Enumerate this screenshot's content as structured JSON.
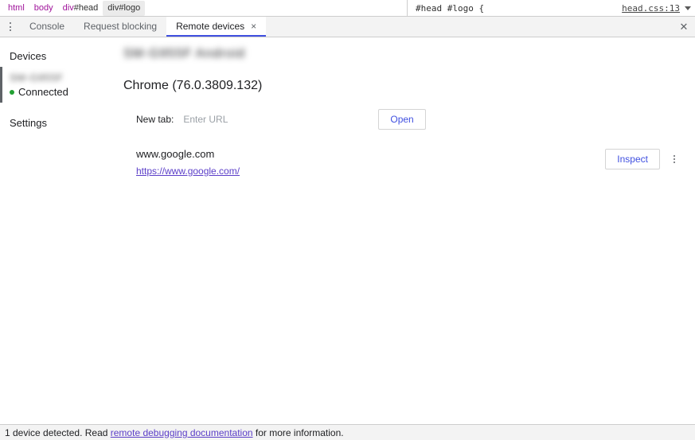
{
  "breadcrumb": {
    "items": [
      {
        "tag": "html",
        "id": "",
        "selected": false
      },
      {
        "tag": "body",
        "id": "",
        "selected": false
      },
      {
        "tag": "div",
        "id": "#head",
        "selected": false
      },
      {
        "tag": "div",
        "id": "#logo",
        "selected": true
      }
    ]
  },
  "styles_rule": {
    "selector": "#head #logo {",
    "origin": "head.css:13",
    "caret_icon": "chevron-down-icon"
  },
  "tabbar": {
    "more_icon": "more-vertical-icon",
    "tabs": [
      {
        "label": "Console",
        "active": false,
        "closable": false
      },
      {
        "label": "Request blocking",
        "active": false,
        "closable": false
      },
      {
        "label": "Remote devices",
        "active": true,
        "closable": true
      }
    ],
    "tab_close_glyph": "×",
    "panel_close_glyph": "✕",
    "panel_close_icon": "close-icon"
  },
  "sidebar": {
    "heading": "Devices",
    "device": {
      "name": "SM-G955F",
      "status": "Connected",
      "status_color": "#22a033",
      "selected": true
    },
    "settings_label": "Settings"
  },
  "main": {
    "device_title": "SM-G955F Android",
    "browser_title": "Chrome (76.0.3809.132)",
    "newtab": {
      "label": "New tab:",
      "input_value": "",
      "input_placeholder": "Enter URL",
      "open_label": "Open"
    },
    "pages": [
      {
        "name": "www.google.com",
        "url": "https://www.google.com/",
        "inspect_label": "Inspect",
        "more_icon": "more-vertical-icon"
      }
    ]
  },
  "statusbar": {
    "text_before": "1 device detected. Read ",
    "link_text": "remote debugging documentation",
    "text_after": " for more information."
  },
  "colors": {
    "accent_blue": "#4050e0",
    "link_purple": "#5b3ec8",
    "tag_magenta": "#a0159b",
    "connected_green": "#22a033"
  }
}
